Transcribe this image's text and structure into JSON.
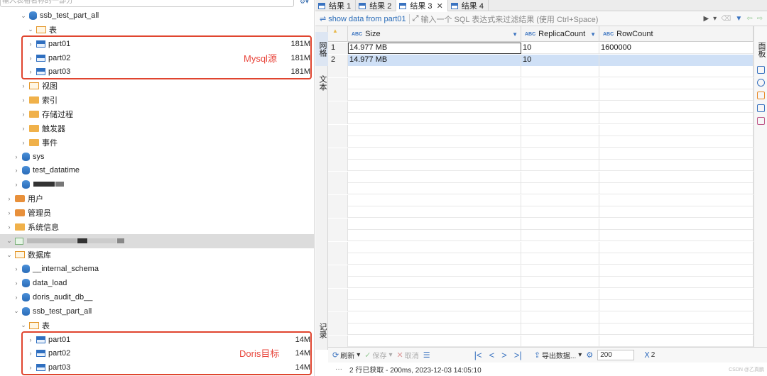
{
  "left_tree": {
    "filter_placeholder": "输入表格名称的一部分",
    "rows": [
      {
        "label": "ssb_test_part_all",
        "arrow": "⌄",
        "icon": "db"
      },
      {
        "label": "表",
        "arrow": "⌄",
        "icon": "folder-open"
      },
      {
        "label": "part01",
        "arrow": "›",
        "icon": "table",
        "size": "181M"
      },
      {
        "label": "part02",
        "arrow": "›",
        "icon": "table",
        "size": "181M"
      },
      {
        "label": "part03",
        "arrow": "›",
        "icon": "table",
        "size": "181M"
      },
      {
        "label": "视图",
        "arrow": "›",
        "icon": "folder-open"
      },
      {
        "label": "索引",
        "arrow": "›",
        "icon": "folder"
      },
      {
        "label": "存储过程",
        "arrow": "›",
        "icon": "folder"
      },
      {
        "label": "触发器",
        "arrow": "›",
        "icon": "folder"
      },
      {
        "label": "事件",
        "arrow": "›",
        "icon": "folder"
      },
      {
        "label": "sys",
        "arrow": "›",
        "icon": "db"
      },
      {
        "label": "test_datatime",
        "arrow": "›",
        "icon": "db"
      },
      {
        "label": "",
        "arrow": "›",
        "icon": "db",
        "redacted": true
      },
      {
        "label": "用户",
        "arrow": "›",
        "icon": "user"
      },
      {
        "label": "管理员",
        "arrow": "›",
        "icon": "user"
      },
      {
        "label": "系统信息",
        "arrow": "›",
        "icon": "folder"
      },
      {
        "label": "",
        "arrow": "⌄",
        "icon": "conn",
        "redacted": true
      },
      {
        "label": "数据库",
        "arrow": "⌄",
        "icon": "folder-open"
      },
      {
        "label": "__internal_schema",
        "arrow": "›",
        "icon": "db"
      },
      {
        "label": "data_load",
        "arrow": "›",
        "icon": "db"
      },
      {
        "label": "doris_audit_db__",
        "arrow": "›",
        "icon": "db"
      },
      {
        "label": "ssb_test_part_all",
        "arrow": "⌄",
        "icon": "db"
      },
      {
        "label": "表",
        "arrow": "⌄",
        "icon": "folder-open"
      },
      {
        "label": "part01",
        "arrow": "›",
        "icon": "table",
        "size": "14M"
      },
      {
        "label": "part02",
        "arrow": "›",
        "icon": "table",
        "size": "14M"
      },
      {
        "label": "part03",
        "arrow": "›",
        "icon": "table",
        "size": "14M"
      }
    ],
    "annotation_top": "Mysql源",
    "annotation_bottom": "Doris目标"
  },
  "tabs": [
    {
      "label": "结果 1",
      "active": false
    },
    {
      "label": "结果 2",
      "active": false
    },
    {
      "label": "结果 3",
      "active": true
    },
    {
      "label": "结果 4",
      "active": false
    }
  ],
  "query": {
    "text": "show data from part01",
    "filter_placeholder": "输入一个 SQL 表达式来过滤结果 (使用 Ctrl+Space)"
  },
  "vertical_tabs": {
    "grid": "网格",
    "text": "文本",
    "record": "记录"
  },
  "panel_label": "面板",
  "grid": {
    "columns": [
      "Size",
      "ReplicaCount",
      "RowCount"
    ],
    "rows": [
      {
        "num": "1",
        "cells": [
          "14.977 MB",
          "10",
          "1600000"
        ]
      },
      {
        "num": "2",
        "cells": [
          "14.977 MB",
          "10",
          ""
        ]
      }
    ]
  },
  "bottom": {
    "refresh": "刷新",
    "save": "保存",
    "cancel": "取消",
    "export": "导出数据...",
    "fetch_size": "200",
    "row_count": "2"
  },
  "status": "2 行已获取 - 200ms, 2023-12-03 14:05:10",
  "watermark": "CSDN @乙真鹏"
}
